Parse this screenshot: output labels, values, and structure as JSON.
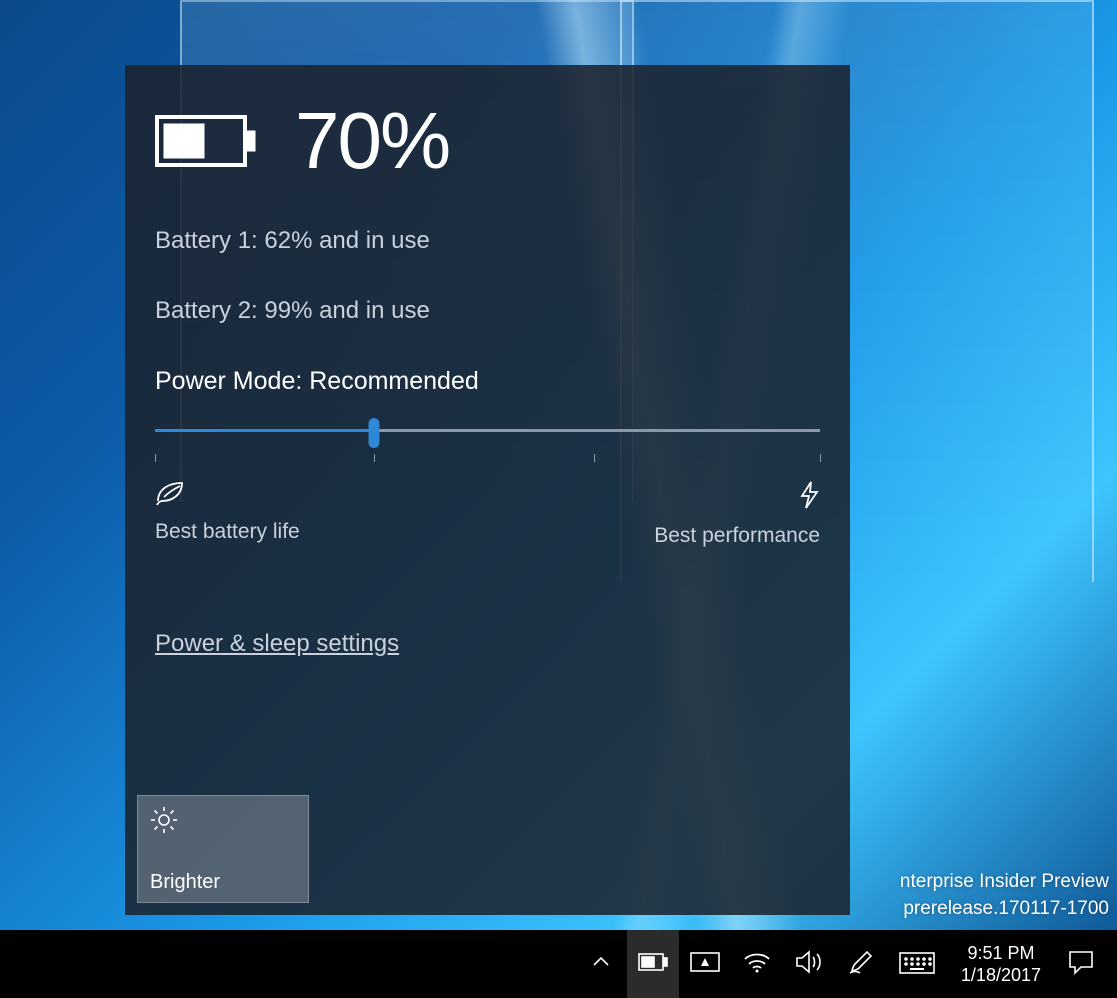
{
  "flyout": {
    "overall_percent": "70%",
    "battery1": "Battery 1: 62% and in use",
    "battery2": "Battery 2: 99% and in use",
    "power_mode_label": "Power Mode: Recommended",
    "slider": {
      "position_percent": 33,
      "ticks": [
        0,
        33,
        66,
        100
      ]
    },
    "left_end_label": "Best battery life",
    "right_end_label": "Best performance",
    "settings_link": "Power & sleep settings",
    "brightness_tile": "Brighter"
  },
  "watermark": {
    "line1": "nterprise Insider Preview",
    "line2": "prerelease.170117-1700"
  },
  "taskbar": {
    "time": "9:51 PM",
    "date": "1/18/2017"
  }
}
